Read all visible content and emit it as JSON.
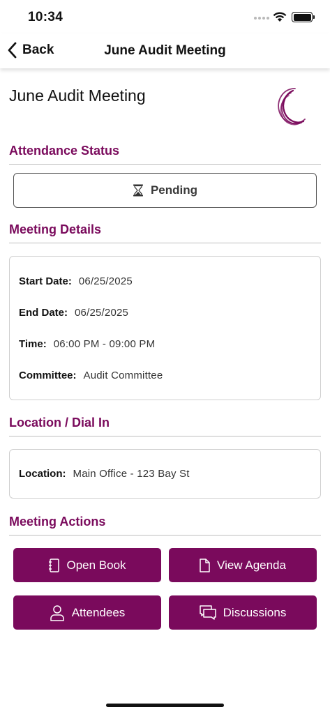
{
  "status_bar": {
    "time": "10:34"
  },
  "nav": {
    "back_label": "Back",
    "title": "June Audit Meeting"
  },
  "page": {
    "title": "June Audit Meeting"
  },
  "attendance": {
    "heading": "Attendance Status",
    "status_label": "Pending",
    "status_icon": "hourglass-icon"
  },
  "meeting_details": {
    "heading": "Meeting Details",
    "rows": [
      {
        "label": "Start Date:",
        "value": "06/25/2025"
      },
      {
        "label": "End Date:",
        "value": "06/25/2025"
      },
      {
        "label": "Time:",
        "value": "06:00 PM - 09:00 PM"
      },
      {
        "label": "Committee:",
        "value": "Audit Committee"
      }
    ]
  },
  "location": {
    "heading": "Location / Dial In",
    "rows": [
      {
        "label": "Location:",
        "value": "Main Office - 123 Bay St"
      }
    ]
  },
  "actions": {
    "heading": "Meeting Actions",
    "buttons": [
      {
        "label": "Open Book",
        "icon": "notebook-icon"
      },
      {
        "label": "View Agenda",
        "icon": "document-icon"
      },
      {
        "label": "Attendees",
        "icon": "person-icon"
      },
      {
        "label": "Discussions",
        "icon": "chat-bubbles-icon"
      }
    ]
  },
  "colors": {
    "accent": "#7a0a5c",
    "divider": "#bdbdbd",
    "card_border": "#cfcfcf"
  }
}
